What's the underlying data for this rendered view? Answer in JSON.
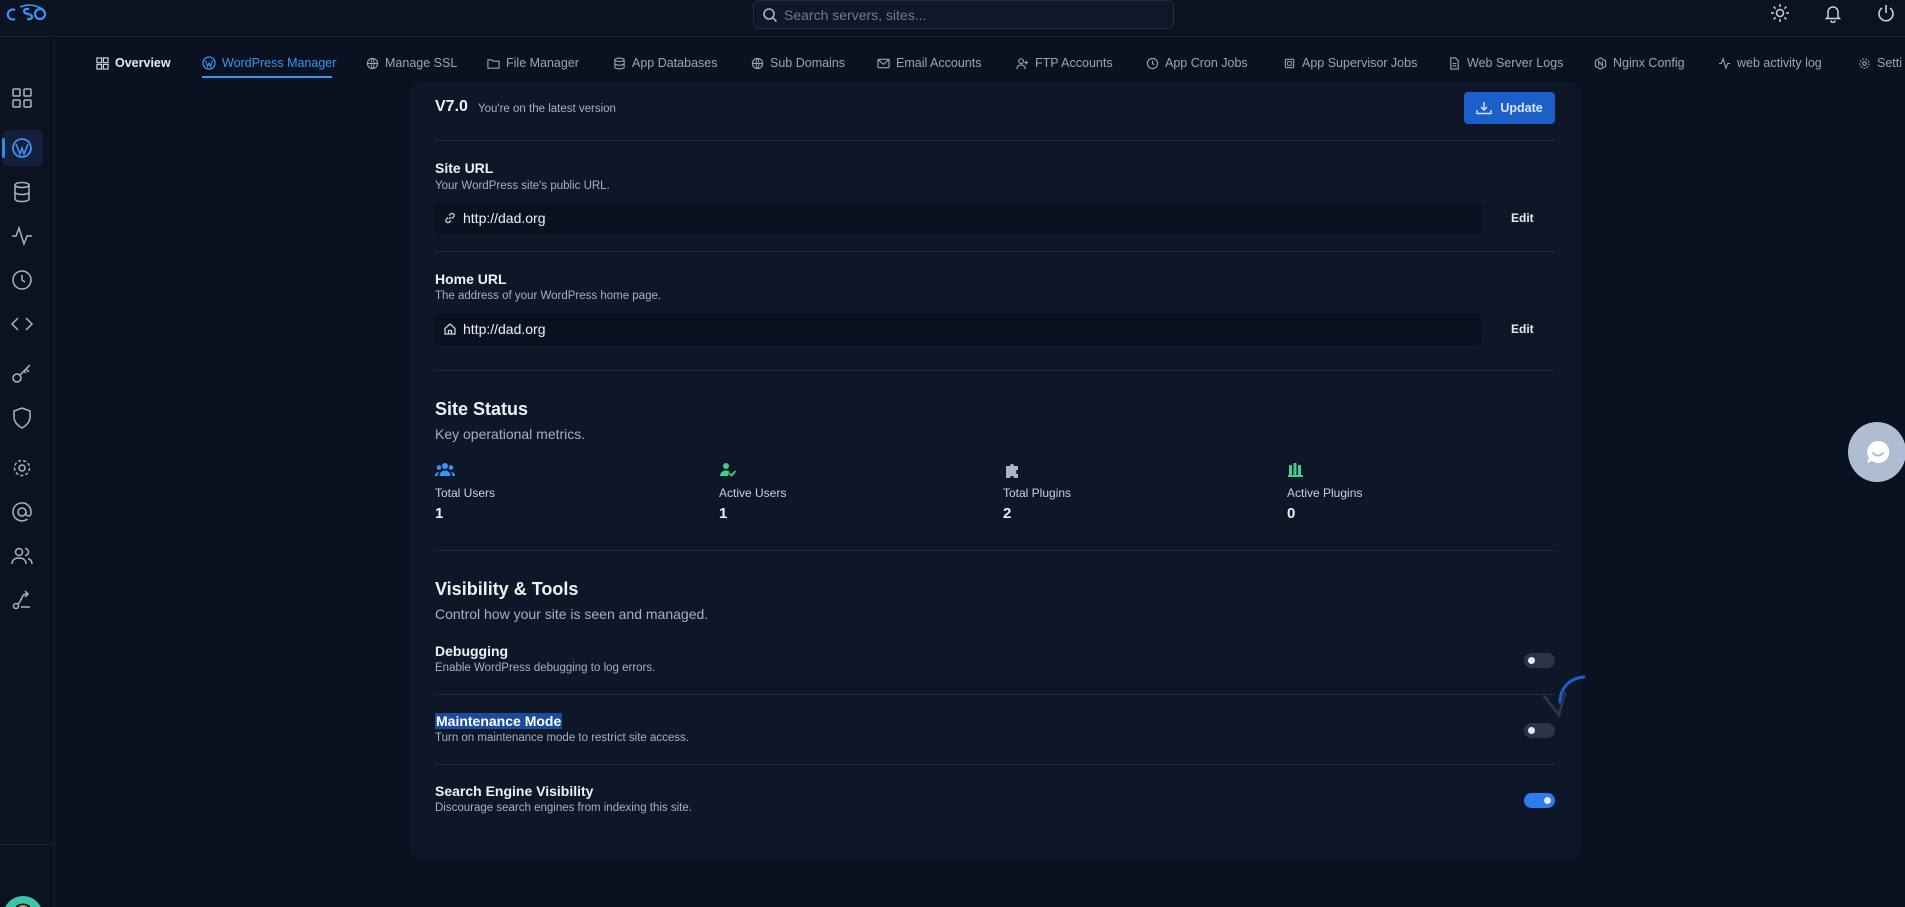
{
  "search": {
    "placeholder": "Search servers, sites..."
  },
  "tabs": [
    {
      "label": "Overview"
    },
    {
      "label": "WordPress Manager"
    },
    {
      "label": "Manage SSL"
    },
    {
      "label": "File Manager"
    },
    {
      "label": "App Databases"
    },
    {
      "label": "Sub Domains"
    },
    {
      "label": "Email Accounts"
    },
    {
      "label": "FTP Accounts"
    },
    {
      "label": "App Cron Jobs"
    },
    {
      "label": "App Supervisor Jobs"
    },
    {
      "label": "Web Server Logs"
    },
    {
      "label": "Nginx Config"
    },
    {
      "label": "web activity log"
    },
    {
      "label": "Setti"
    }
  ],
  "version": {
    "number": "V7.0",
    "note": "You're on the latest version",
    "update_label": "Update"
  },
  "site_url": {
    "title": "Site URL",
    "desc": "Your WordPress site's public URL.",
    "value": "http://dad.org",
    "edit_label": "Edit"
  },
  "home_url": {
    "title": "Home URL",
    "desc": "The address of your WordPress home page.",
    "value": "http://dad.org",
    "edit_label": "Edit"
  },
  "status": {
    "title": "Site Status",
    "desc": "Key operational metrics.",
    "metrics": [
      {
        "label": "Total Users",
        "value": "1"
      },
      {
        "label": "Active Users",
        "value": "1"
      },
      {
        "label": "Total Plugins",
        "value": "2"
      },
      {
        "label": "Active Plugins",
        "value": "0"
      }
    ]
  },
  "tools": {
    "title": "Visibility & Tools",
    "desc": "Control how your site is seen and managed.",
    "items": [
      {
        "title": "Debugging",
        "desc": "Enable WordPress debugging to log errors.",
        "enabled": false
      },
      {
        "title": "Maintenance Mode",
        "desc": "Turn on maintenance mode to restrict site access.",
        "enabled": false
      },
      {
        "title": "Search Engine Visibility",
        "desc": "Discourage search engines from indexing this site.",
        "enabled": true
      }
    ]
  },
  "colors": {
    "accent": "#3b93f5",
    "toggle_on": "#2d7cf0",
    "update_btn": "#1d5fc9",
    "green_icon": "#3ecf8e"
  }
}
